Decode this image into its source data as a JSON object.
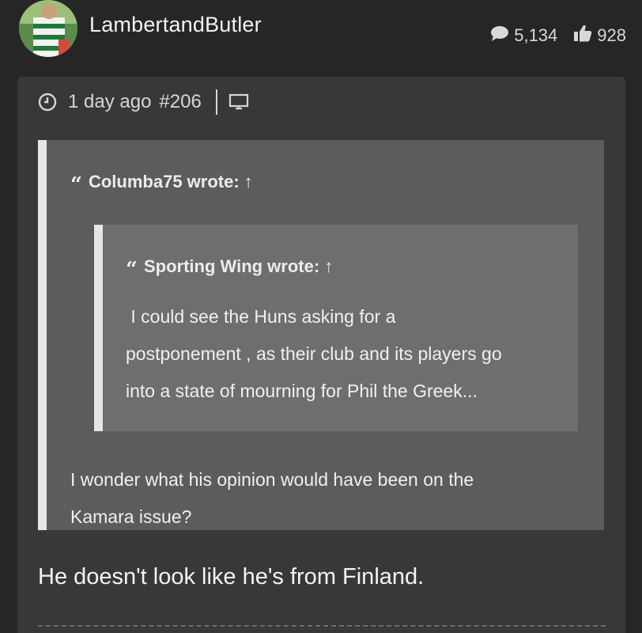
{
  "user": {
    "name": "LambertandButler",
    "posts": "5,134",
    "likes": "928"
  },
  "post": {
    "time": "1 day ago",
    "number": "#206",
    "quote": {
      "author": "Columba75 wrote:",
      "arrow": "↑",
      "nested": {
        "author": "Sporting Wing wrote:",
        "arrow": "↑",
        "lines": [
          " I could see the Huns asking for a",
          "postponement , as their club and its players go",
          "into a state of mourning for Phil the Greek..."
        ]
      },
      "lines": [
        "I wonder what his opinion would have been on the",
        "Kamara issue?"
      ]
    },
    "reply": "He doesn't look like he's from Finland."
  },
  "colors": {
    "background": "#262626",
    "card": "#383838",
    "quote_outer": "#5c5c5c",
    "quote_inner": "#6e6e6e",
    "quote_border": "#e6e6e6"
  }
}
